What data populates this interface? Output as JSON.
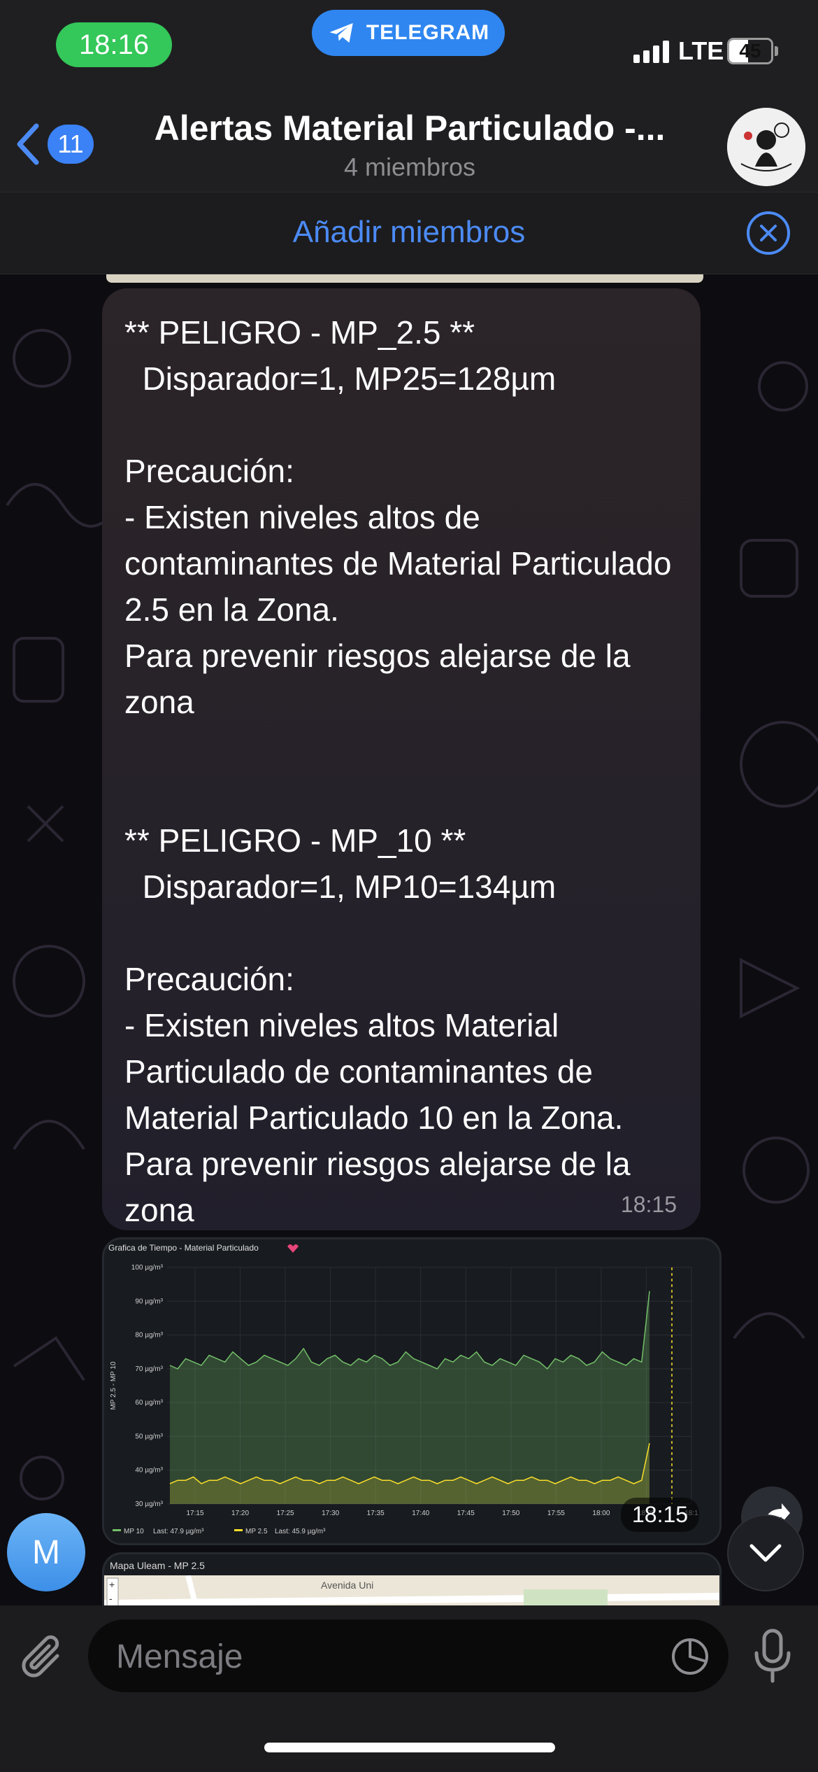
{
  "status_bar": {
    "time": "18:16",
    "app": "TELEGRAM",
    "network": "LTE",
    "battery": "45",
    "battery_level": 0.45
  },
  "header": {
    "back_count": "11",
    "title": "Alertas Material Particulado -...",
    "subtitle": "4 miembros"
  },
  "add_members": {
    "label": "Añadir miembros"
  },
  "message": {
    "text": "** PELIGRO - MP_2.5 **\n  Disparador=1, MP25=128µm\n\nPrecaución:\n- Existen niveles altos de contaminantes de Material Particulado 2.5 en la Zona.\nPara prevenir riesgos alejarse de la zona\n\n\n** PELIGRO - MP_10 **\n  Disparador=1, MP10=134µm\n\nPrecaución:\n- Existen niveles altos Material Particulado de contaminantes de Material Particulado 10 en la Zona.\nPara prevenir riesgos alejarse de la zona",
    "time": "18:15"
  },
  "image_message": {
    "time": "18:15"
  },
  "map_message": {
    "title": "Mapa Uleam - MP 2.5",
    "street": "Avenida Uni"
  },
  "sender": {
    "initial": "M"
  },
  "composer": {
    "placeholder": "Mensaje"
  },
  "colors": {
    "accent": "#4c8bf5",
    "mp10": "#73bf69",
    "mp25": "#fade2a"
  },
  "chart_data": {
    "type": "area",
    "title": "Grafica de Tiempo - Material Particulado",
    "ylabel": "MP 2.5 - MP 10",
    "ylim": [
      30,
      100
    ],
    "yticks": [
      "30 µg/m³",
      "40 µg/m³",
      "50 µg/m³",
      "60 µg/m³",
      "70 µg/m³",
      "80 µg/m³",
      "90 µg/m³",
      "100 µg/m³"
    ],
    "xticks": [
      "17:15",
      "17:20",
      "17:25",
      "17:30",
      "17:35",
      "17:40",
      "17:45",
      "17:50",
      "17:55",
      "18:00",
      "18:05",
      "18:1"
    ],
    "series": [
      {
        "name": "MP 10",
        "legend": "Last: 47.9 µg/m³",
        "color": "#73bf69",
        "values": [
          71,
          70,
          73,
          72,
          71,
          74,
          73,
          72,
          75,
          73,
          71,
          72,
          74,
          73,
          72,
          71,
          73,
          76,
          72,
          71,
          73,
          74,
          72,
          71,
          73,
          72,
          74,
          73,
          71,
          72,
          75,
          73,
          72,
          71,
          70,
          73,
          72,
          74,
          73,
          75,
          72,
          71,
          73,
          72,
          71,
          74,
          73,
          72,
          70,
          73,
          72,
          74,
          73,
          71,
          72,
          75,
          73,
          72,
          71,
          73,
          72,
          93
        ]
      },
      {
        "name": "MP 2.5",
        "legend": "Last: 45.9 µg/m³",
        "color": "#fade2a",
        "values": [
          36,
          37,
          37,
          38,
          36,
          37,
          37,
          38,
          37,
          36,
          37,
          38,
          37,
          37,
          36,
          37,
          38,
          37,
          37,
          36,
          37,
          37,
          38,
          37,
          36,
          37,
          38,
          37,
          37,
          36,
          37,
          38,
          37,
          37,
          36,
          37,
          37,
          38,
          37,
          36,
          37,
          38,
          37,
          36,
          37,
          37,
          38,
          37,
          37,
          36,
          37,
          38,
          37,
          37,
          36,
          37,
          37,
          38,
          37,
          36,
          37,
          48
        ]
      }
    ]
  }
}
